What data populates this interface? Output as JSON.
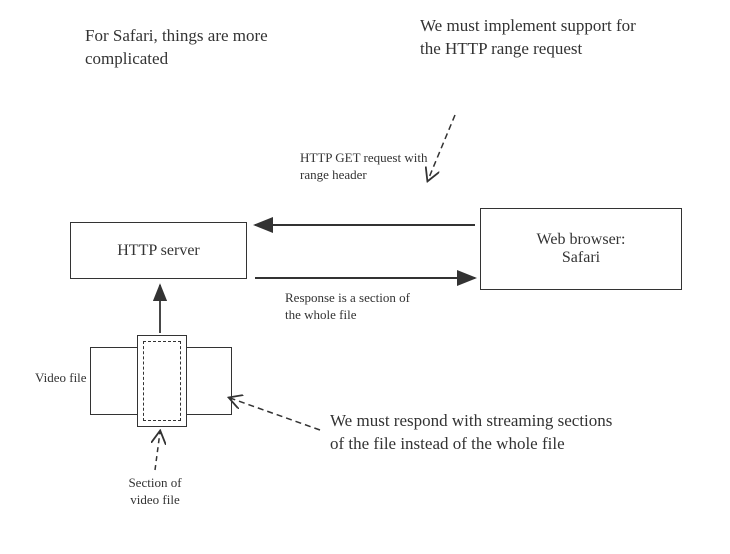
{
  "texts": {
    "title_left": "For Safari, things are more complicated",
    "title_right": "We must implement support for the HTTP range request",
    "request_label": "HTTP GET request with range header",
    "response_label": "Response is a section of the whole file",
    "explanation": "We must respond with streaming sections of the file instead of the whole file"
  },
  "boxes": {
    "server_label": "HTTP server",
    "browser_label_line1": "Web browser:",
    "browser_label_line2": "Safari"
  },
  "labels": {
    "video_file": "Video file",
    "section_label_line1": "Section of",
    "section_label_line2": "video file"
  }
}
